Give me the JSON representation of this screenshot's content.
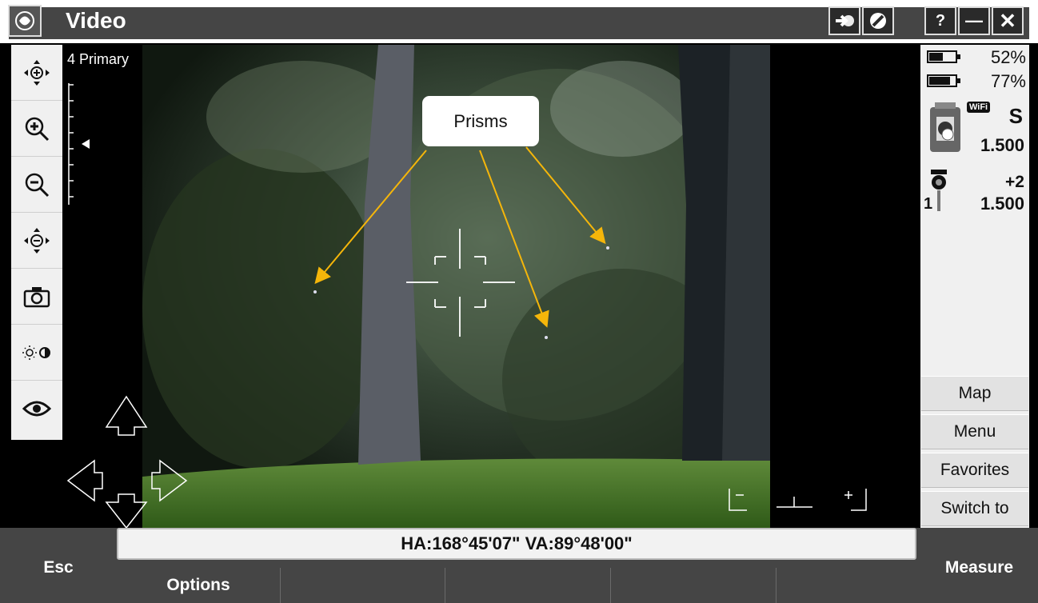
{
  "titlebar": {
    "title": "Video"
  },
  "camera": {
    "mode_label": "4 Primary"
  },
  "status": {
    "battery1": "52%",
    "battery2": "77%",
    "wifi_label": "WiFi",
    "instrument_letter": "S",
    "instrument_height": "1.500",
    "prism_number": "1",
    "prism_offset": "+2",
    "target_height": "1.500"
  },
  "side_buttons": {
    "map": "Map",
    "menu": "Menu",
    "favorites": "Favorites",
    "switch_to": "Switch to"
  },
  "angles": {
    "text": "HA:168°45'07\"  VA:89°48'00\""
  },
  "function_keys": {
    "esc": "Esc",
    "options": "Options",
    "measure": "Measure"
  },
  "annotation": {
    "callout": "Prisms"
  },
  "colors": {
    "chrome": "#454545",
    "panel": "#f0f0f0",
    "arrow": "#f5b60a"
  },
  "icons": [
    "rose-logo-icon",
    "exit-arrow-icon",
    "cancel-icon",
    "help-icon",
    "minimize-icon",
    "close-icon",
    "autolock-icon",
    "zoom-in-icon",
    "zoom-out-icon",
    "zoom-fit-icon",
    "camera-icon",
    "brightness-icon",
    "eye-icon",
    "battery-icon",
    "instrument-icon",
    "prism-target-icon"
  ]
}
